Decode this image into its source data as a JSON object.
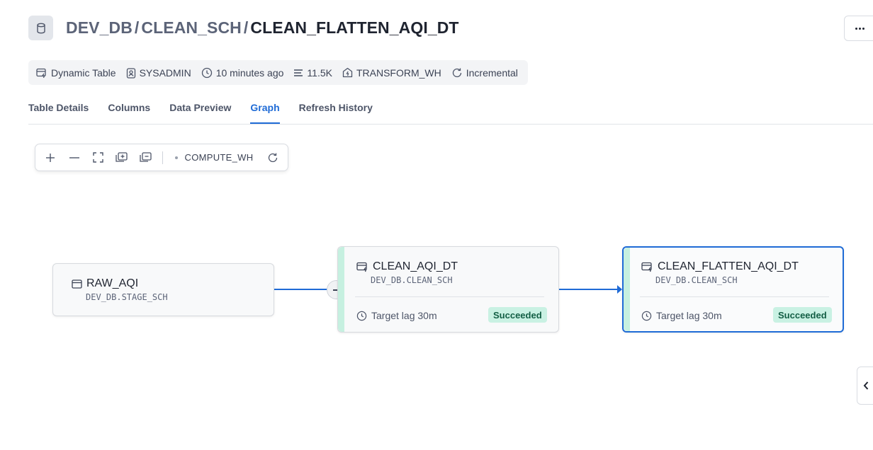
{
  "header": {
    "breadcrumb": [
      "DEV_DB",
      "CLEAN_SCH",
      "CLEAN_FLATTEN_AQI_DT"
    ],
    "separator": "/"
  },
  "meta": {
    "type": "Dynamic Table",
    "owner": "SYSADMIN",
    "updated": "10 minutes ago",
    "rows": "11.5K",
    "warehouse": "TRANSFORM_WH",
    "refresh_mode": "Incremental"
  },
  "tabs": [
    {
      "label": "Table Details",
      "active": false
    },
    {
      "label": "Columns",
      "active": false
    },
    {
      "label": "Data Preview",
      "active": false
    },
    {
      "label": "Graph",
      "active": true
    },
    {
      "label": "Refresh History",
      "active": false
    }
  ],
  "toolbar": {
    "warehouse": "COMPUTE_WH"
  },
  "graph": {
    "nodes": [
      {
        "name": "RAW_AQI",
        "path": "DEV_DB.STAGE_SCH",
        "kind": "table"
      },
      {
        "name": "CLEAN_AQI_DT",
        "path": "DEV_DB.CLEAN_SCH",
        "kind": "dynamic-table",
        "lag": "Target lag 30m",
        "status": "Succeeded"
      },
      {
        "name": "CLEAN_FLATTEN_AQI_DT",
        "path": "DEV_DB.CLEAN_SCH",
        "kind": "dynamic-table",
        "lag": "Target lag 30m",
        "status": "Succeeded",
        "selected": true
      }
    ]
  },
  "colors": {
    "accent": "#1f6bd6",
    "success_bg": "#c9f1e3",
    "success_text": "#125e44",
    "node_accent": "#c6f0e0"
  }
}
